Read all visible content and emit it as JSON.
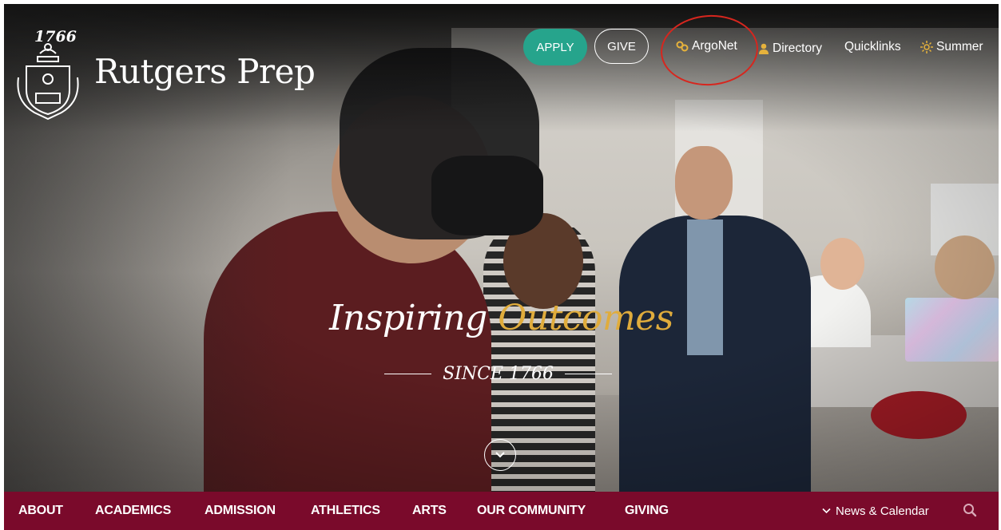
{
  "site": {
    "year": "1766",
    "name": "Rutgers Prep"
  },
  "utility_nav": {
    "apply": "APPLY",
    "give": "GIVE",
    "argonet": "ArgoNet",
    "directory": "Directory",
    "quicklinks": "Quicklinks",
    "summer": "Summer"
  },
  "hero": {
    "headline_main": "Inspiring",
    "headline_accent": "Outcomes",
    "since": "SINCE 1766"
  },
  "main_nav": {
    "items": [
      "ABOUT",
      "ACADEMICS",
      "ADMISSION",
      "ATHLETICS",
      "ARTS",
      "OUR COMMUNITY",
      "GIVING"
    ],
    "news_calendar": "News & Calendar"
  },
  "colors": {
    "nav_bar": "#7a0a2b",
    "apply_button": "#26a48c",
    "accent_gold": "#e0ac3c",
    "annotation_circle": "#d7261e"
  },
  "icons": {
    "argonet": "link-icon",
    "directory": "person-icon",
    "summer": "sun-icon",
    "scroll": "chevron-down-icon",
    "search": "search-icon"
  }
}
